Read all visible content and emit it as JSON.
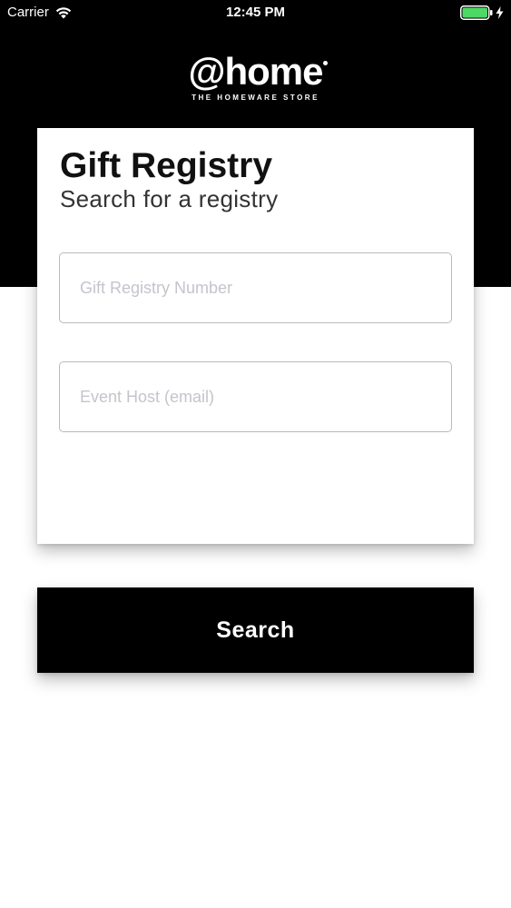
{
  "status_bar": {
    "carrier": "Carrier",
    "time": "12:45 PM",
    "wifi_icon": "wifi-icon",
    "battery_icon": "battery-icon",
    "charging_icon": "bolt-icon",
    "battery_color": "#4cd964"
  },
  "header": {
    "logo_text": "@home",
    "tagline": "THE HOMEWARE STORE"
  },
  "card": {
    "title": "Gift Registry",
    "subtitle": "Search for a registry",
    "registry_number": {
      "value": "",
      "placeholder": "Gift Registry Number"
    },
    "event_host": {
      "value": "",
      "placeholder": "Event Host (email)"
    }
  },
  "actions": {
    "search_label": "Search"
  },
  "colors": {
    "header_bg": "#000000",
    "button_bg": "#000000",
    "button_text": "#ffffff"
  }
}
